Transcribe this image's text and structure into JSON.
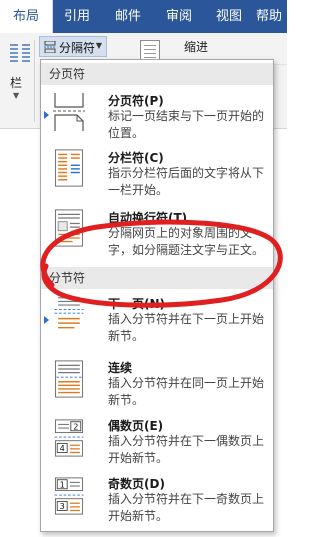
{
  "ribbon_tabs": [
    {
      "label": "布局",
      "active": true
    },
    {
      "label": "引用",
      "active": false
    },
    {
      "label": "邮件",
      "active": false
    },
    {
      "label": "审阅",
      "active": false
    },
    {
      "label": "视图",
      "active": false
    },
    {
      "label": "帮助",
      "active": false
    }
  ],
  "ribbon": {
    "columns_label": "栏",
    "breaks_button_label": "分隔符",
    "indent_label": "缩进"
  },
  "breaks_menu": {
    "page_breaks_header": "分页符",
    "section_breaks_header": "分节符",
    "items": [
      {
        "title": "分页符(P)",
        "desc": "标记一页结束与下一页开始的位置。"
      },
      {
        "title": "分栏符(C)",
        "desc": "指示分栏符后面的文字将从下一栏开始。"
      },
      {
        "title": "自动换行符(T)",
        "desc": "分隔网页上的对象周围的文字，如分隔题注文字与正文。"
      },
      {
        "title": "下一页(N)",
        "desc": "插入分节符并在下一页上开始新节。"
      },
      {
        "title": "连续",
        "desc": "插入分节符并在同一页上开始新节。"
      },
      {
        "title": "偶数页(E)",
        "desc": "插入分节符并在下一偶数页上开始新节。"
      },
      {
        "title": "奇数页(D)",
        "desc": "插入分节符并在下一奇数页上开始新节。"
      }
    ]
  },
  "page_icon_numbers": {
    "even": [
      "2",
      "4"
    ],
    "odd": [
      "1",
      "3"
    ]
  },
  "colors": {
    "ribbon_blue": "#2b579a",
    "annotation_red": "#e02020",
    "orange_lines": "#e07a1f"
  }
}
